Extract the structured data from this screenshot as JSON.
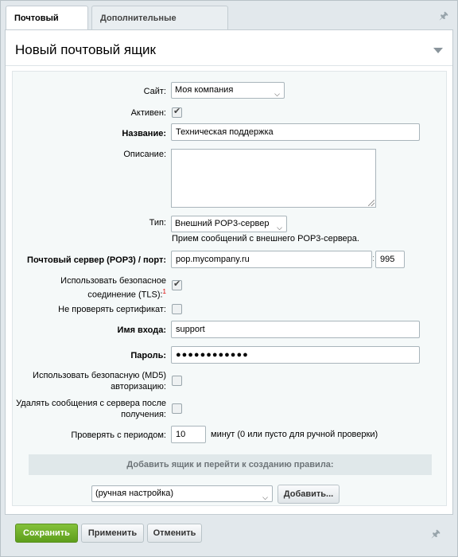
{
  "tabs": {
    "mailbox": "Почтовый ящик",
    "advanced": "Дополнительные настройки"
  },
  "panel": {
    "title": "Новый почтовый ящик"
  },
  "form": {
    "site": {
      "label": "Сайт:",
      "value": "Моя компания"
    },
    "active": {
      "label": "Активен:",
      "checked": true
    },
    "name": {
      "label": "Название:",
      "value": "Техническая поддержка"
    },
    "description": {
      "label": "Описание:",
      "value": ""
    },
    "type": {
      "label": "Тип:",
      "value": "Внешний POP3-сервер",
      "note": "Прием сообщений с внешнего POP3-сервера."
    },
    "server": {
      "label": "Почтовый сервер (POP3) / порт:",
      "host": "pop.mycompany.ru",
      "port": "995",
      "separator": ":"
    },
    "tls": {
      "label": "Использовать безопасное соединение (TLS):",
      "footnote": "1",
      "checked": true
    },
    "no_cert_check": {
      "label": "Не проверять сертификат:",
      "checked": false
    },
    "login": {
      "label": "Имя входа:",
      "value": "support"
    },
    "password": {
      "label": "Пароль:",
      "value": "●●●●●●●●●●●●"
    },
    "md5": {
      "label": "Использовать безопасную (MD5) авторизацию:",
      "checked": false
    },
    "delete_after": {
      "label": "Удалять сообщения с сервера после получения:",
      "checked": false
    },
    "period": {
      "label": "Проверять с периодом:",
      "value": "10",
      "note": "минут (0 или пусто для ручной проверки)"
    }
  },
  "rule_section": {
    "title": "Добавить ящик и перейти к созданию правила:",
    "select_value": "(ручная настройка)",
    "add_button": "Добавить..."
  },
  "footer": {
    "save": "Сохранить",
    "apply": "Применить",
    "cancel": "Отменить"
  },
  "colors": {
    "save_green": "#6aab23",
    "background": "#e2e8ec",
    "form_background": "#f5f9f9",
    "footnote_red": "#dd0000"
  }
}
